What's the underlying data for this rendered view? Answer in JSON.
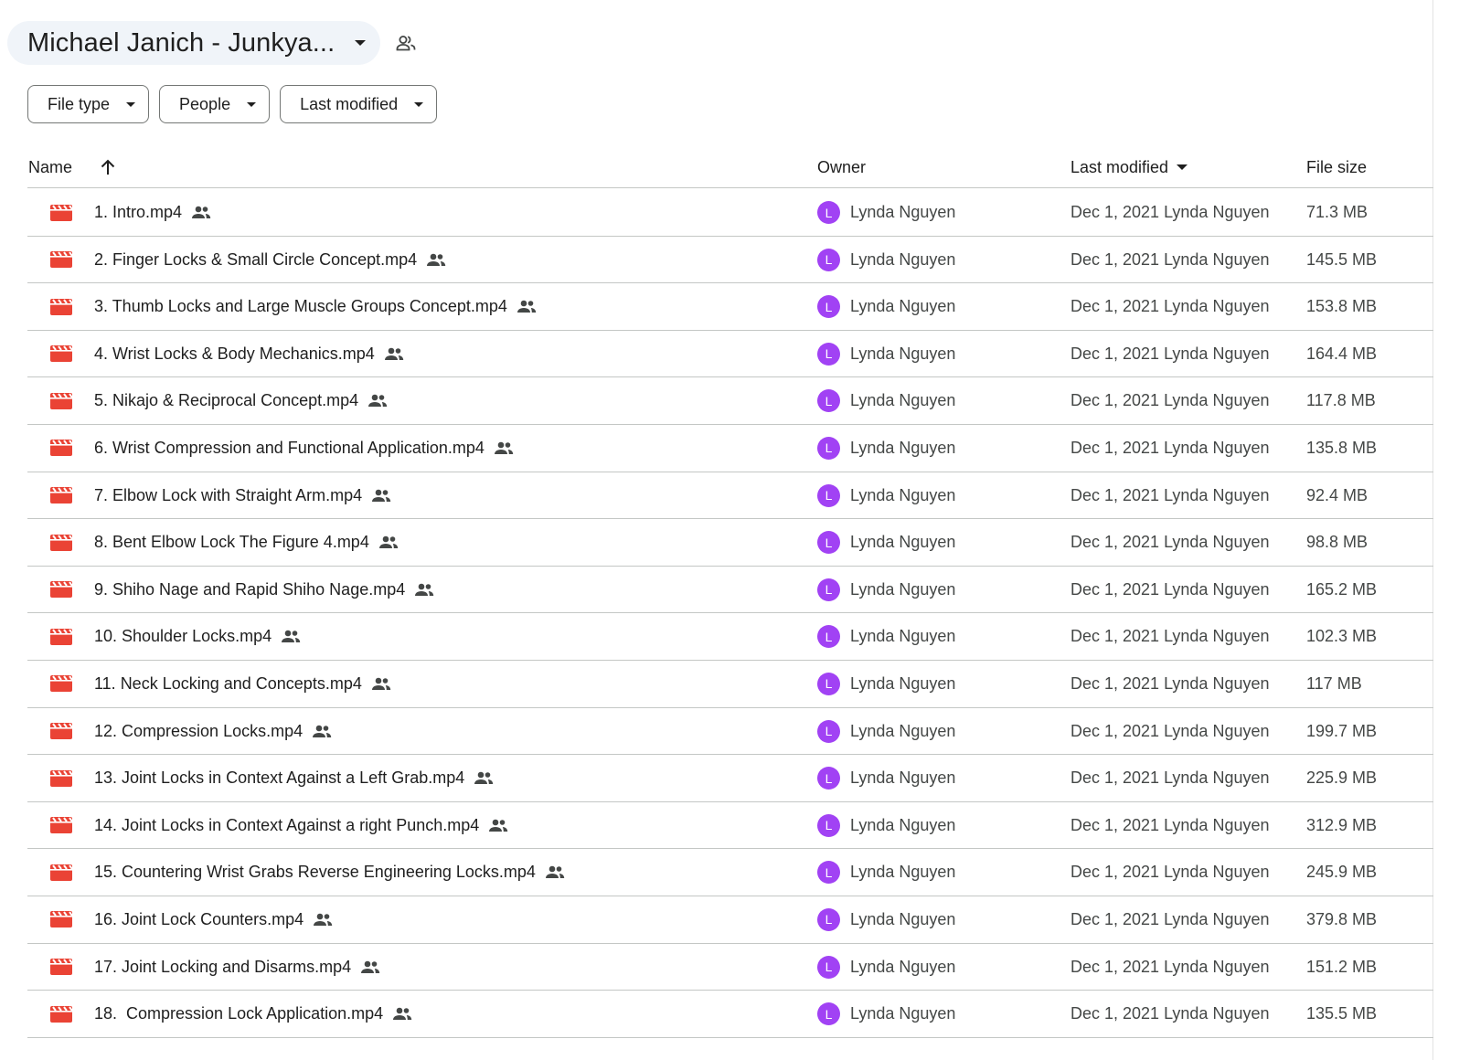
{
  "folder": {
    "title": "Michael Janich - Junkya...",
    "title_dropdown_icon": "caret-down-icon",
    "shared_icon": "shared-people-icon"
  },
  "filters": [
    {
      "label": "File type",
      "icon": "caret-down-icon"
    },
    {
      "label": "People",
      "icon": "caret-down-icon"
    },
    {
      "label": "Last modified",
      "icon": "caret-down-icon"
    }
  ],
  "columns": {
    "name": "Name",
    "sort_icon": "arrow-up-icon",
    "owner": "Owner",
    "last_modified": "Last modified",
    "last_modified_sort_icon": "caret-down-icon",
    "file_size": "File size"
  },
  "colors": {
    "video_icon": "#ea4335",
    "avatar": "#a142f4",
    "title_pill": "#f0f4f9",
    "divider": "#c4c7c5"
  },
  "files": [
    {
      "name": "1. Intro.mp4",
      "owner": "Lynda Nguyen",
      "owner_initial": "L",
      "modified": "Dec 1, 2021 Lynda Nguyen",
      "size": "71.3 MB"
    },
    {
      "name": "2. Finger Locks & Small Circle Concept.mp4",
      "owner": "Lynda Nguyen",
      "owner_initial": "L",
      "modified": "Dec 1, 2021 Lynda Nguyen",
      "size": "145.5 MB"
    },
    {
      "name": "3. Thumb Locks and Large Muscle Groups Concept.mp4",
      "owner": "Lynda Nguyen",
      "owner_initial": "L",
      "modified": "Dec 1, 2021 Lynda Nguyen",
      "size": "153.8 MB"
    },
    {
      "name": "4. Wrist Locks & Body Mechanics.mp4",
      "owner": "Lynda Nguyen",
      "owner_initial": "L",
      "modified": "Dec 1, 2021 Lynda Nguyen",
      "size": "164.4 MB"
    },
    {
      "name": "5. Nikajo & Reciprocal Concept.mp4",
      "owner": "Lynda Nguyen",
      "owner_initial": "L",
      "modified": "Dec 1, 2021 Lynda Nguyen",
      "size": "117.8 MB"
    },
    {
      "name": "6. Wrist Compression and Functional Application.mp4",
      "owner": "Lynda Nguyen",
      "owner_initial": "L",
      "modified": "Dec 1, 2021 Lynda Nguyen",
      "size": "135.8 MB"
    },
    {
      "name": "7. Elbow Lock with Straight Arm.mp4",
      "owner": "Lynda Nguyen",
      "owner_initial": "L",
      "modified": "Dec 1, 2021 Lynda Nguyen",
      "size": "92.4 MB"
    },
    {
      "name": "8. Bent Elbow Lock The Figure 4.mp4",
      "owner": "Lynda Nguyen",
      "owner_initial": "L",
      "modified": "Dec 1, 2021 Lynda Nguyen",
      "size": "98.8 MB"
    },
    {
      "name": "9. Shiho Nage and Rapid Shiho Nage.mp4",
      "owner": "Lynda Nguyen",
      "owner_initial": "L",
      "modified": "Dec 1, 2021 Lynda Nguyen",
      "size": "165.2 MB"
    },
    {
      "name": "10. Shoulder Locks.mp4",
      "owner": "Lynda Nguyen",
      "owner_initial": "L",
      "modified": "Dec 1, 2021 Lynda Nguyen",
      "size": "102.3 MB"
    },
    {
      "name": "11. Neck Locking and Concepts.mp4",
      "owner": "Lynda Nguyen",
      "owner_initial": "L",
      "modified": "Dec 1, 2021 Lynda Nguyen",
      "size": "117 MB"
    },
    {
      "name": "12. Compression Locks.mp4",
      "owner": "Lynda Nguyen",
      "owner_initial": "L",
      "modified": "Dec 1, 2021 Lynda Nguyen",
      "size": "199.7 MB"
    },
    {
      "name": "13. Joint Locks in Context Against a Left Grab.mp4",
      "owner": "Lynda Nguyen",
      "owner_initial": "L",
      "modified": "Dec 1, 2021 Lynda Nguyen",
      "size": "225.9 MB"
    },
    {
      "name": "14. Joint Locks in Context Against a right Punch.mp4",
      "owner": "Lynda Nguyen",
      "owner_initial": "L",
      "modified": "Dec 1, 2021 Lynda Nguyen",
      "size": "312.9 MB"
    },
    {
      "name": "15. Countering Wrist Grabs Reverse Engineering Locks.mp4",
      "owner": "Lynda Nguyen",
      "owner_initial": "L",
      "modified": "Dec 1, 2021 Lynda Nguyen",
      "size": "245.9 MB"
    },
    {
      "name": "16. Joint Lock Counters.mp4",
      "owner": "Lynda Nguyen",
      "owner_initial": "L",
      "modified": "Dec 1, 2021 Lynda Nguyen",
      "size": "379.8 MB"
    },
    {
      "name": "17. Joint Locking and Disarms.mp4",
      "owner": "Lynda Nguyen",
      "owner_initial": "L",
      "modified": "Dec 1, 2021 Lynda Nguyen",
      "size": "151.2 MB"
    },
    {
      "name": "18.  Compression Lock Application.mp4",
      "owner": "Lynda Nguyen",
      "owner_initial": "L",
      "modified": "Dec 1, 2021 Lynda Nguyen",
      "size": "135.5 MB"
    }
  ]
}
